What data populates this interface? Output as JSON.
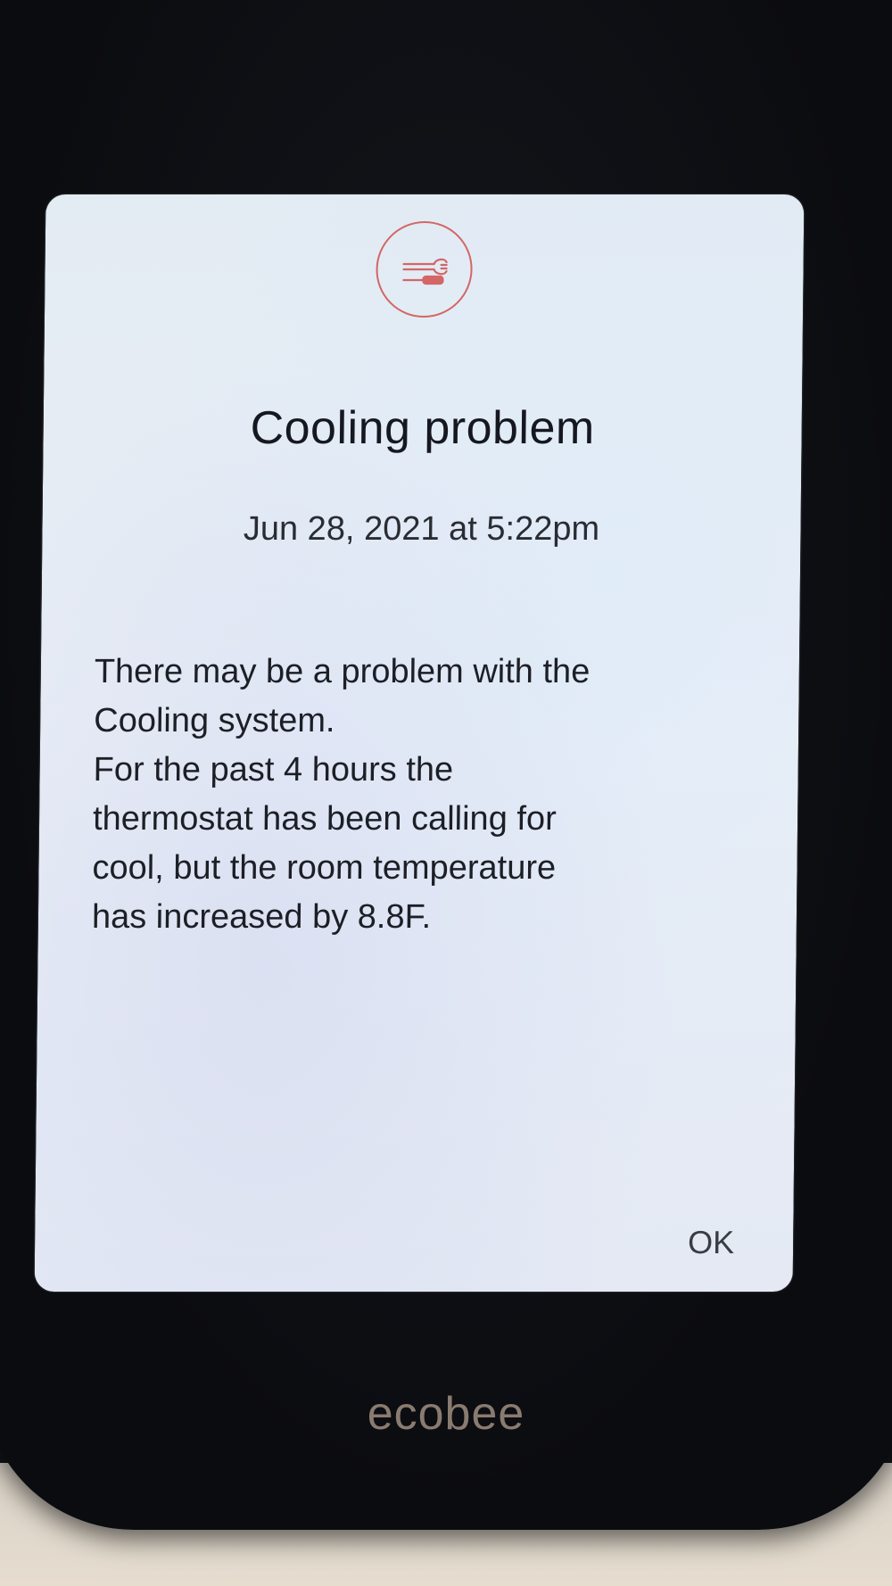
{
  "dialog": {
    "icon": "wrench-screwdriver-icon",
    "title": "Cooling problem",
    "datetime": "Jun 28, 2021 at 5:22pm",
    "message_lines": [
      "There may be a problem with the",
      "Cooling system.",
      "For the past 4 hours the",
      "thermostat has been calling for",
      "cool, but the room temperature",
      "has increased by 8.8F."
    ],
    "ok_label": "OK"
  },
  "device": {
    "brand": "ecobee"
  },
  "colors": {
    "icon_accent": "#d46666",
    "text": "#161820",
    "screen_bg": "#e6edf5",
    "brand": "#8a7b70"
  }
}
